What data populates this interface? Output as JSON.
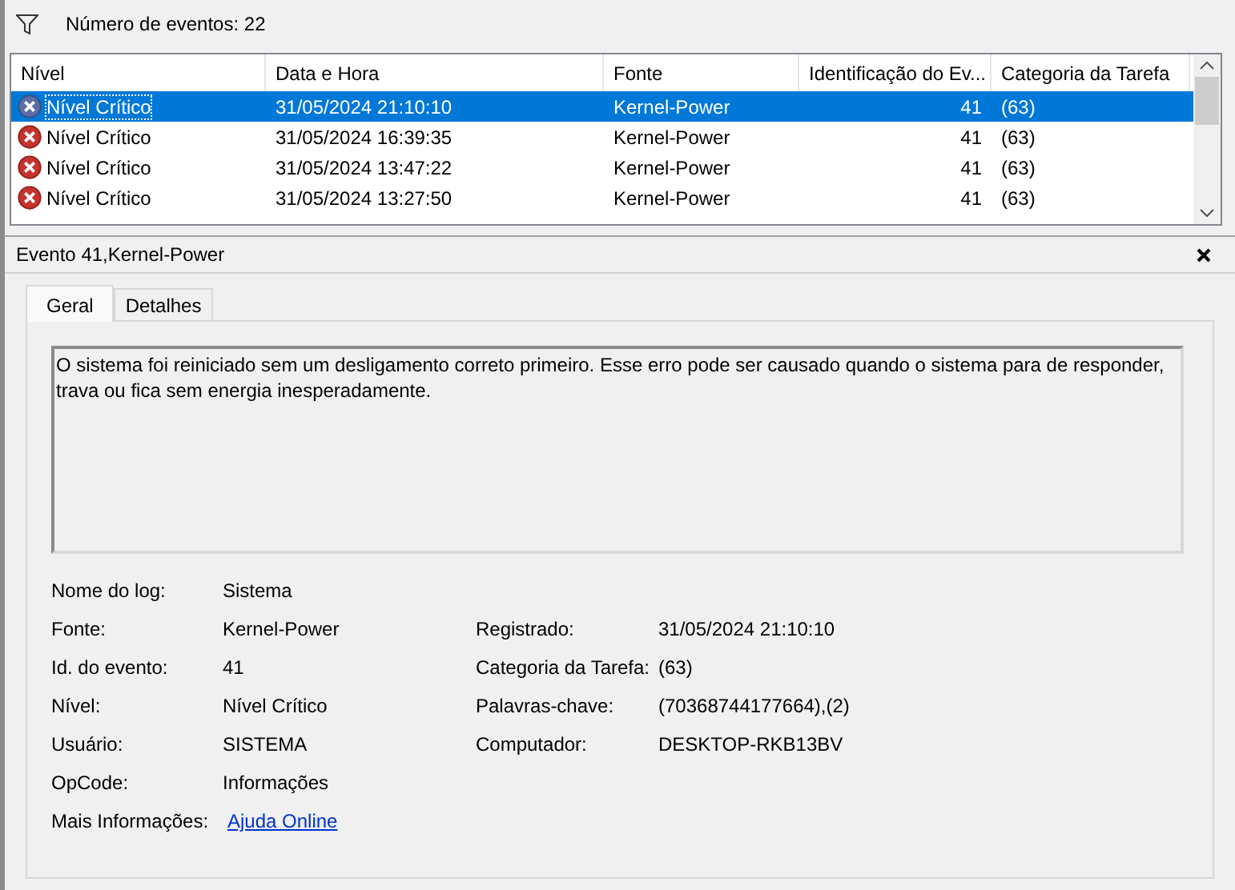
{
  "toolbar": {
    "event_count": "Número de eventos: 22"
  },
  "table": {
    "columns": [
      "Nível",
      "Data e Hora",
      "Fonte",
      "Identificação do Ev...",
      "Categoria da Tarefa"
    ],
    "rows": [
      {
        "level": "Nível Crítico",
        "datetime": "31/05/2024 21:10:10",
        "source": "Kernel-Power",
        "id": "41",
        "category": "(63)",
        "selected": true
      },
      {
        "level": "Nível Crítico",
        "datetime": "31/05/2024 16:39:35",
        "source": "Kernel-Power",
        "id": "41",
        "category": "(63)",
        "selected": false
      },
      {
        "level": "Nível Crítico",
        "datetime": "31/05/2024 13:47:22",
        "source": "Kernel-Power",
        "id": "41",
        "category": "(63)",
        "selected": false
      },
      {
        "level": "Nível Crítico",
        "datetime": "31/05/2024 13:27:50",
        "source": "Kernel-Power",
        "id": "41",
        "category": "(63)",
        "selected": false
      }
    ]
  },
  "detail": {
    "title": "Evento 41,Kernel-Power",
    "tabs": [
      {
        "label": "Geral",
        "selected": true
      },
      {
        "label": "Detalhes",
        "selected": false
      }
    ],
    "description": "O sistema foi reiniciado sem um desligamento correto primeiro. Esse erro pode ser causado quando o sistema para de responder, trava ou fica sem energia inesperadamente.",
    "fields": [
      {
        "left": {
          "label": "Nome do log:",
          "value": "Sistema"
        }
      },
      {
        "left": {
          "label": "Fonte:",
          "value": "Kernel-Power"
        },
        "right": {
          "label": "Registrado:",
          "value": "31/05/2024 21:10:10"
        }
      },
      {
        "left": {
          "label": "Id. do evento:",
          "value": "41"
        },
        "right": {
          "label": "Categoria da Tarefa:",
          "value": "(63)"
        }
      },
      {
        "left": {
          "label": "Nível:",
          "value": "Nível Crítico"
        },
        "right": {
          "label": "Palavras-chave:",
          "value": "(70368744177664),(2)"
        }
      },
      {
        "left": {
          "label": "Usuário:",
          "value": "SISTEMA"
        },
        "right": {
          "label": "Computador:",
          "value": "DESKTOP-RKB13BV"
        }
      },
      {
        "left": {
          "label": "OpCode:",
          "value": "Informações"
        }
      },
      {
        "left": {
          "label": "Mais Informações:",
          "value": "Ajuda Online",
          "kind": "link"
        }
      }
    ]
  }
}
